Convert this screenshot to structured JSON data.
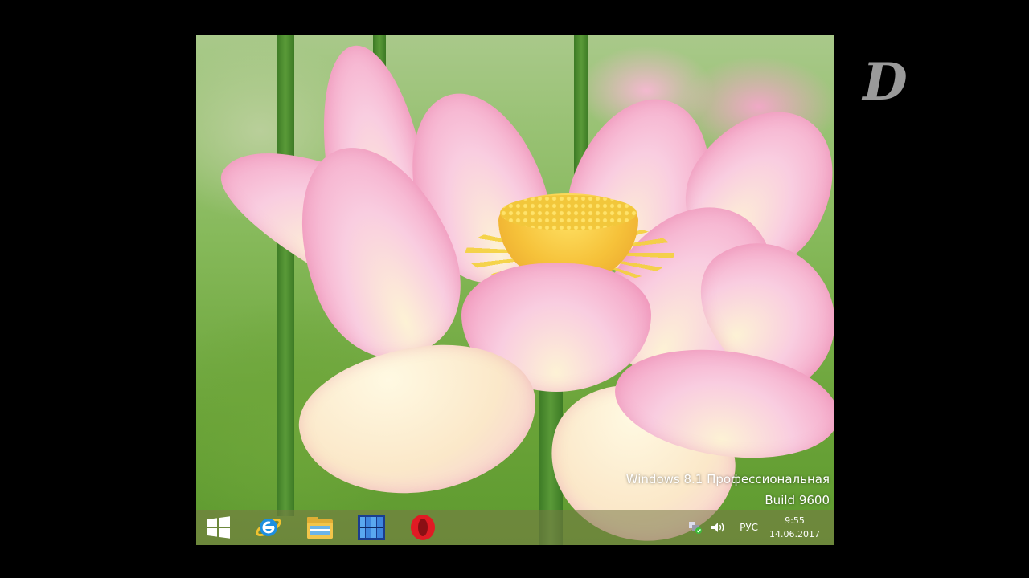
{
  "os": {
    "edition_line": "Windows 8.1 Профессиональная",
    "build_line": "Build 9600"
  },
  "taskbar": {
    "pinned": [
      {
        "name": "start",
        "icon": "windows-logo-icon"
      },
      {
        "name": "internet-explorer",
        "icon": "internet-explorer-icon"
      },
      {
        "name": "file-explorer",
        "icon": "folder-icon"
      },
      {
        "name": "app",
        "icon": "library-app-icon"
      },
      {
        "name": "opera",
        "icon": "opera-icon"
      }
    ],
    "tray": {
      "language": "РУС",
      "time": "9:55",
      "date": "14.06.2017"
    }
  },
  "logo": {
    "letter": "D"
  },
  "colors": {
    "taskbar": "#78784680",
    "opera_red": "#e01b24",
    "ie_blue": "#1d8fe0",
    "folder_yellow": "#f3c54a"
  }
}
